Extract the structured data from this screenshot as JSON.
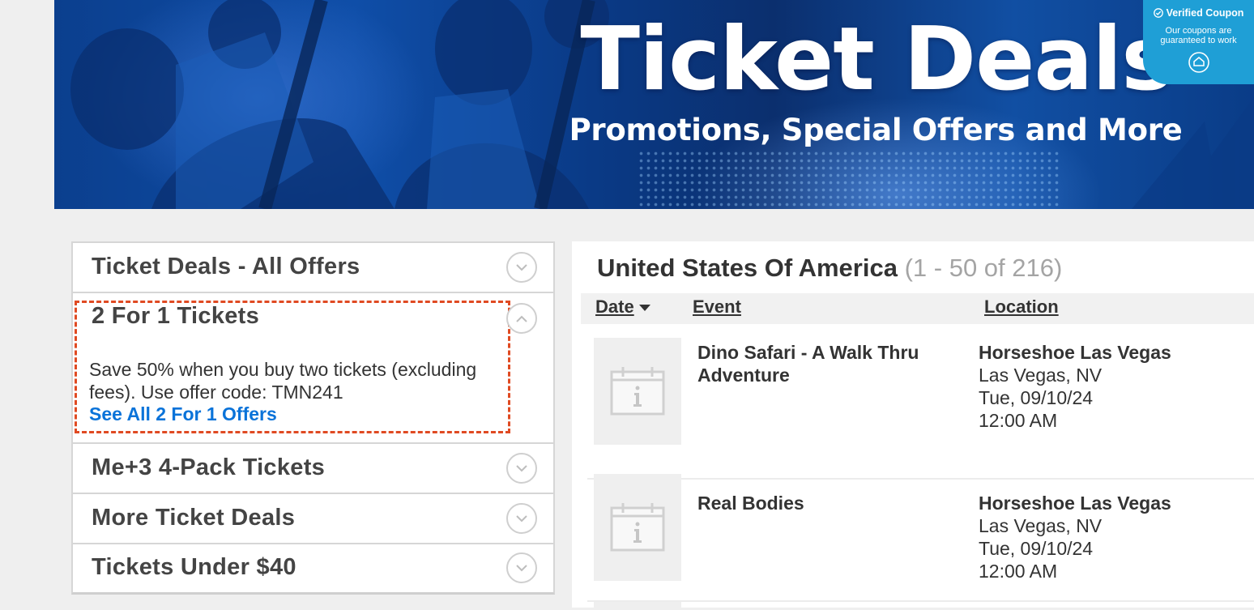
{
  "banner": {
    "title": "Ticket Deals",
    "subtitle": "Promotions, Special Offers and More",
    "verified": {
      "title": "Verified Coupon",
      "text": "Our coupons are guaranteed to work",
      "icon": "shield-check-icon"
    }
  },
  "sidebar": {
    "items": [
      {
        "label": "Ticket Deals - All Offers",
        "icon": "chevron-down-icon"
      },
      {
        "label": "2 For 1 Tickets",
        "icon": "chevron-up-icon",
        "description": "Save 50% when you buy two tickets (excluding fees). Use offer code: TMN241",
        "link": "See All 2 For 1 Offers"
      },
      {
        "label": "Me+3 4-Pack Tickets",
        "icon": "chevron-down-icon"
      },
      {
        "label": "More Ticket Deals",
        "icon": "chevron-down-icon"
      },
      {
        "label": "Tickets Under $40",
        "icon": "chevron-down-icon"
      }
    ]
  },
  "main": {
    "title": "United States Of America",
    "count": "(1 - 50 of 216)",
    "columns": {
      "date": "Date",
      "event": "Event",
      "location": "Location"
    },
    "events": [
      {
        "name": "Dino Safari - A Walk Thru Adventure",
        "venue": "Horseshoe Las Vegas",
        "city": "Las Vegas, NV",
        "date": "Tue, 09/10/24",
        "time": "12:00 AM",
        "thumb": "calendar-info-icon"
      },
      {
        "name": "Real Bodies",
        "venue": "Horseshoe Las Vegas",
        "city": "Las Vegas, NV",
        "date": "Tue, 09/10/24",
        "time": "12:00 AM",
        "thumb": "calendar-info-icon"
      }
    ]
  },
  "colors": {
    "accent_link": "#0a73d9",
    "highlight_dashed": "#e04a22",
    "verified_bg": "#1f9fd6",
    "banner_blue": "#0f4ea8"
  }
}
